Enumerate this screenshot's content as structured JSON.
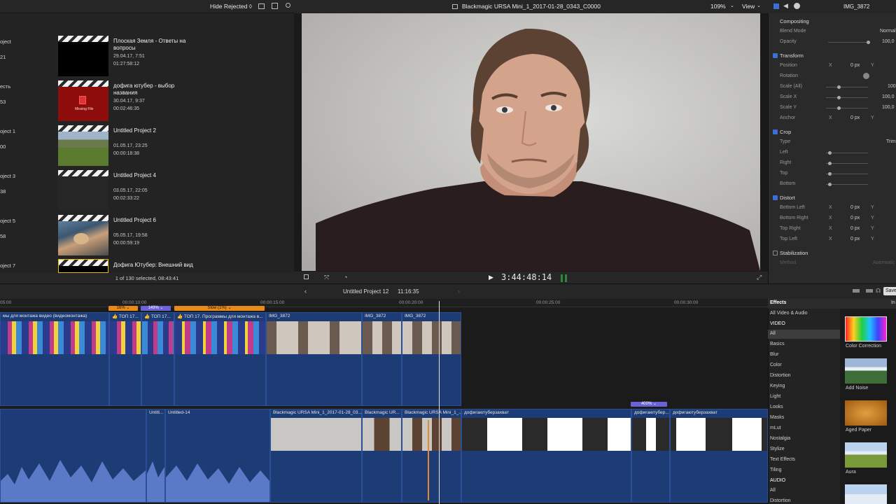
{
  "browser": {
    "toolbar": {
      "filter": "Hide Rejected ◊"
    },
    "projects": [
      {
        "left_title": "oject",
        "left_date": "21",
        "left_dur": "",
        "title": "Плоская Земля - Ответы на вопросы",
        "date": "29.04.17, 7:51",
        "duration": "01:27:58:12"
      },
      {
        "left_title": "есть",
        "left_date": "53",
        "left_dur": "",
        "title": "дофига ютубер - выбор названия",
        "date": "30.04.17, 9:37",
        "duration": "00:02:46:35"
      },
      {
        "left_title": "oject 1",
        "left_date": "00",
        "left_dur": "",
        "title": "Untitled Project 2",
        "date": "01.05.17, 23:25",
        "duration": "00:00:18:38"
      },
      {
        "left_title": "oject 3",
        "left_date": "38",
        "left_dur": "",
        "title": "Untitled Project 4",
        "date": "03.05.17, 22:05",
        "duration": "00:02:33:22"
      },
      {
        "left_title": "oject 5",
        "left_date": "58",
        "left_dur": "",
        "title": "Untitled Project 6",
        "date": "05.05.17, 19:58",
        "duration": "00:00:59:19"
      },
      {
        "left_title": "oject 7",
        "left_date": "",
        "left_dur": "",
        "title": "Дофига Ютубер: Внешний вид",
        "date": "",
        "duration": ""
      }
    ],
    "missing_file": "Missing File",
    "footer": "1 of 130 selected, 08:43:41"
  },
  "viewer": {
    "title": "Blackmagic URSA Mini_1_2017-01-28_0343_C0000",
    "zoom": "109%",
    "view": "View",
    "timecode": "3:44:48:14"
  },
  "inspector": {
    "clip_name": "IMG_3872",
    "compositing": "Compositing",
    "blend_mode_label": "Blend Mode",
    "blend_mode_value": "Normal",
    "opacity_label": "Opacity",
    "opacity_value": "100,0",
    "transform": "Transform",
    "position": "Position",
    "rotation": "Rotation",
    "scale_all": "Scale (All)",
    "scale_x": "Scale X",
    "scale_y": "Scale Y",
    "anchor": "Anchor",
    "crop": "Crop",
    "type": "Type",
    "type_value": "Trim",
    "left": "Left",
    "right": "Right",
    "top": "Top",
    "bottom": "Bottom",
    "distort": "Distort",
    "bottom_left": "Bottom Left",
    "bottom_right": "Bottom Right",
    "top_right": "Top Right",
    "top_left": "Top Left",
    "stabilization": "Stabilization",
    "method": "Method",
    "method_value": "Automatic",
    "x": "X",
    "y": "Y",
    "zero_px": "0 px",
    "hundred": "100",
    "hundred_zero": "100,0",
    "save": "Save"
  },
  "timeline": {
    "project": "Untitled Project 12",
    "duration": "11:16:35",
    "ticks": [
      "05:00",
      "00:00:10:00",
      "00:00:15:00",
      "00:00:20:00",
      "00:00:25:00",
      "00:00:30:00"
    ],
    "speeds": [
      "16% ⌄",
      "149% ⌄",
      "Slow (1%) ⌄",
      "400% ⌄"
    ],
    "upper_clips": [
      "мы для монтажа видео (видеомонтажа)",
      "👍 ТОП 17...",
      "👍 ТОП 17...",
      "👍 ТОП 17. Программы для монтажа в...",
      "IMG_3872",
      "IMG_3872",
      "IMG_3872"
    ],
    "lower_clips": [
      "Untitl...",
      "Untitled-14",
      "Blackmagic URSA Mini_1_2017-01-28_03...",
      "Blackmagic UR...",
      "Blackmagic URSA Mini_1_...",
      "дофигаютуберзахват",
      "дофигаютубер...",
      "дофигаютуберзахват"
    ]
  },
  "effects": {
    "header": "Effects",
    "all_video_audio": "All Video & Audio",
    "video_section": "VIDEO",
    "items": [
      "All",
      "Basics",
      "Blur",
      "Color",
      "Distortion",
      "Keying",
      "Light",
      "Looks",
      "Masks",
      "mLut",
      "Nostalgia",
      "Stylize",
      "Text Effects",
      "Tiling"
    ],
    "audio_section": "AUDIO",
    "audio_items": [
      "All",
      "Distortion"
    ],
    "grid_header": "In",
    "thumbs": [
      "Color Correction",
      "Add Noise",
      "Aged Paper",
      "Aura"
    ]
  }
}
